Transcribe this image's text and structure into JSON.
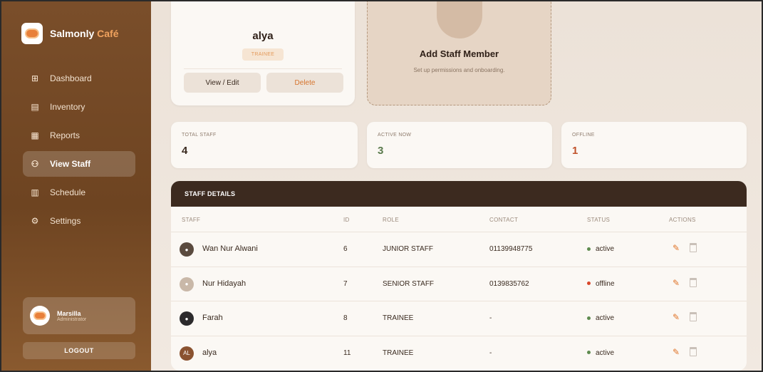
{
  "brand": {
    "name": "Salmonly",
    "accent": "Café"
  },
  "nav": [
    {
      "label": "Dashboard",
      "icon": "⊞",
      "active": false
    },
    {
      "label": "Inventory",
      "icon": "▤",
      "active": false
    },
    {
      "label": "Reports",
      "icon": "▦",
      "active": false
    },
    {
      "label": "View Staff",
      "icon": "⚇",
      "active": true
    },
    {
      "label": "Schedule",
      "icon": "▥",
      "active": false
    },
    {
      "label": "Settings",
      "icon": "⚙",
      "active": false
    }
  ],
  "profile": {
    "name": "Marsilla",
    "role": "Administrator"
  },
  "logout_label": "LOGOUT",
  "staff_card": {
    "name": "alya",
    "badge": "TRAINEE",
    "view_label": "View / Edit",
    "delete_label": "Delete"
  },
  "add_card": {
    "title": "Add Staff Member",
    "subtitle": "Set up permissions and onboarding."
  },
  "stats": [
    {
      "label": "TOTAL STAFF",
      "value": "4",
      "color": "#3a2a1f"
    },
    {
      "label": "ACTIVE NOW",
      "value": "3",
      "color": "#5a7a4c"
    },
    {
      "label": "OFFLINE",
      "value": "1",
      "color": "#c0522a"
    }
  ],
  "table": {
    "title": "STAFF DETAILS",
    "columns": [
      "STAFF",
      "ID",
      "ROLE",
      "CONTACT",
      "STATUS",
      "ACTIONS"
    ],
    "rows": [
      {
        "name": "Wan Nur Alwani",
        "id": "6",
        "role": "JUNIOR STAFF",
        "contact": "01139948775",
        "status": "active",
        "avatar": ""
      },
      {
        "name": "Nur Hidayah",
        "id": "7",
        "role": "SENIOR STAFF",
        "contact": "0139835762",
        "status": "offline",
        "avatar": ""
      },
      {
        "name": "Farah",
        "id": "8",
        "role": "TRAINEE",
        "contact": "-",
        "status": "active",
        "avatar": ""
      },
      {
        "name": "alya",
        "id": "11",
        "role": "TRAINEE",
        "contact": "-",
        "status": "active",
        "avatar": "AL"
      }
    ]
  },
  "colors": {
    "active_dot": "#5e8b4f",
    "offline_dot": "#d9472a",
    "edit_icon": "#e0752a"
  }
}
